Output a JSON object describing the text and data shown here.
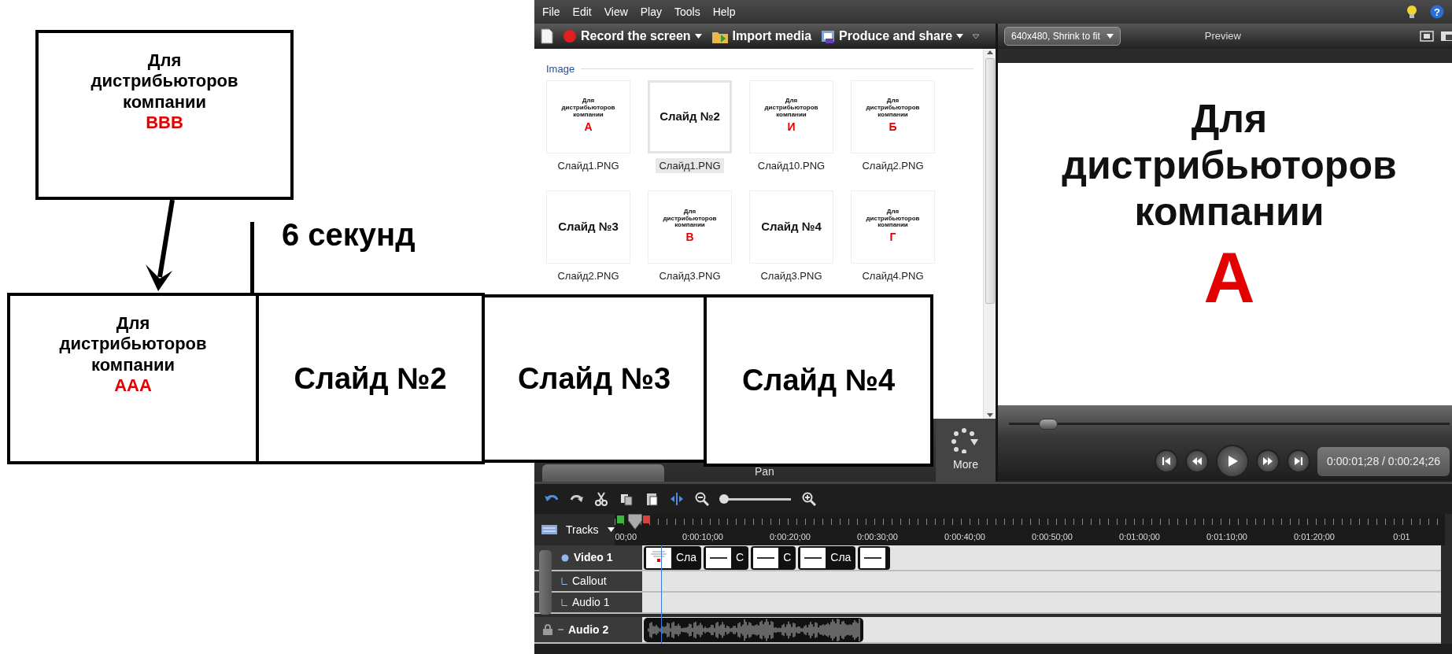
{
  "menu": [
    "File",
    "Edit",
    "View",
    "Play",
    "Tools",
    "Help"
  ],
  "help_icon": "?",
  "toolbar": [
    {
      "kind": "record",
      "label": "Record the screen",
      "dropdown": true
    },
    {
      "kind": "import",
      "label": "Import media",
      "dropdown": false
    },
    {
      "kind": "produce",
      "label": "Produce and share",
      "dropdown": true
    }
  ],
  "media_bin": {
    "group": "Image",
    "items": [
      {
        "kind": "company",
        "text": "Для дистрибьюторов компании",
        "letter": "А",
        "caption": "Слайд1.PNG",
        "selected": false
      },
      {
        "kind": "title",
        "text": "Слайд №2",
        "caption": "Слайд1.PNG",
        "selected": true
      },
      {
        "kind": "company",
        "text": "Для дистрибьюторов компании",
        "letter": "И",
        "caption": "Слайд10.PNG",
        "selected": false
      },
      {
        "kind": "company",
        "text": "Для дистрибьюторов компании",
        "letter": "Б",
        "caption": "Слайд2.PNG",
        "selected": false
      },
      {
        "kind": "title",
        "text": "Слайд №3",
        "caption": "Слайд2.PNG",
        "selected": false
      },
      {
        "kind": "company",
        "text": "Для дистрибьюторов компании",
        "letter": "В",
        "caption": "Слайд3.PNG",
        "selected": false
      },
      {
        "kind": "title",
        "text": "Слайд №4",
        "caption": "Слайд3.PNG",
        "selected": false
      },
      {
        "kind": "company",
        "text": "Для дистрибьюторов компании",
        "letter": "Г",
        "caption": "Слайд4.PNG",
        "selected": false
      }
    ]
  },
  "panel_tabs": {
    "more": "More",
    "pan": "Pan"
  },
  "preview": {
    "size": "640x480, Shrink to fit",
    "title": "Preview",
    "slide_text": "Для дистрибьюторов компании",
    "slide_letter": "А",
    "level": 0.09,
    "time": "0:00:01;28 / 0:00:24;26"
  },
  "timeline": {
    "zoom": {
      "level": 0.05
    },
    "tracks_label": "Tracks",
    "playhead": {
      "level": 0.024
    },
    "ticks": [
      "00;00",
      "0:00:10;00",
      "0:00:20;00",
      "0:00:30;00",
      "0:00:40;00",
      "0:00:50;00",
      "0:01:00;00",
      "0:01:10;00",
      "0:01:20;00",
      "0:01"
    ],
    "tracks": [
      {
        "kind": "video",
        "name": "Video 1",
        "clips": [
          {
            "kind": "company",
            "label": "Сла"
          },
          {
            "kind": "title",
            "label": "С"
          },
          {
            "kind": "title",
            "label": "С"
          },
          {
            "kind": "title",
            "label": "Сла"
          },
          {
            "kind": "title"
          }
        ]
      },
      {
        "kind": "sub",
        "name": "Callout"
      },
      {
        "kind": "sub",
        "name": "Audio 1"
      },
      {
        "kind": "audio",
        "name": "Audio 2"
      }
    ]
  },
  "annotations": {
    "source": {
      "text": "Для дистрибьюторов компании",
      "code": "ВВВ"
    },
    "duration": "6 секунд",
    "slides": [
      {
        "kind": "company",
        "text": "Для дистрибьюторов компании",
        "code": "ААА"
      },
      {
        "kind": "title",
        "text": "Слайд №2"
      },
      {
        "kind": "title",
        "text": "Слайд №3"
      },
      {
        "kind": "title",
        "text": "Слайд №4"
      }
    ]
  }
}
